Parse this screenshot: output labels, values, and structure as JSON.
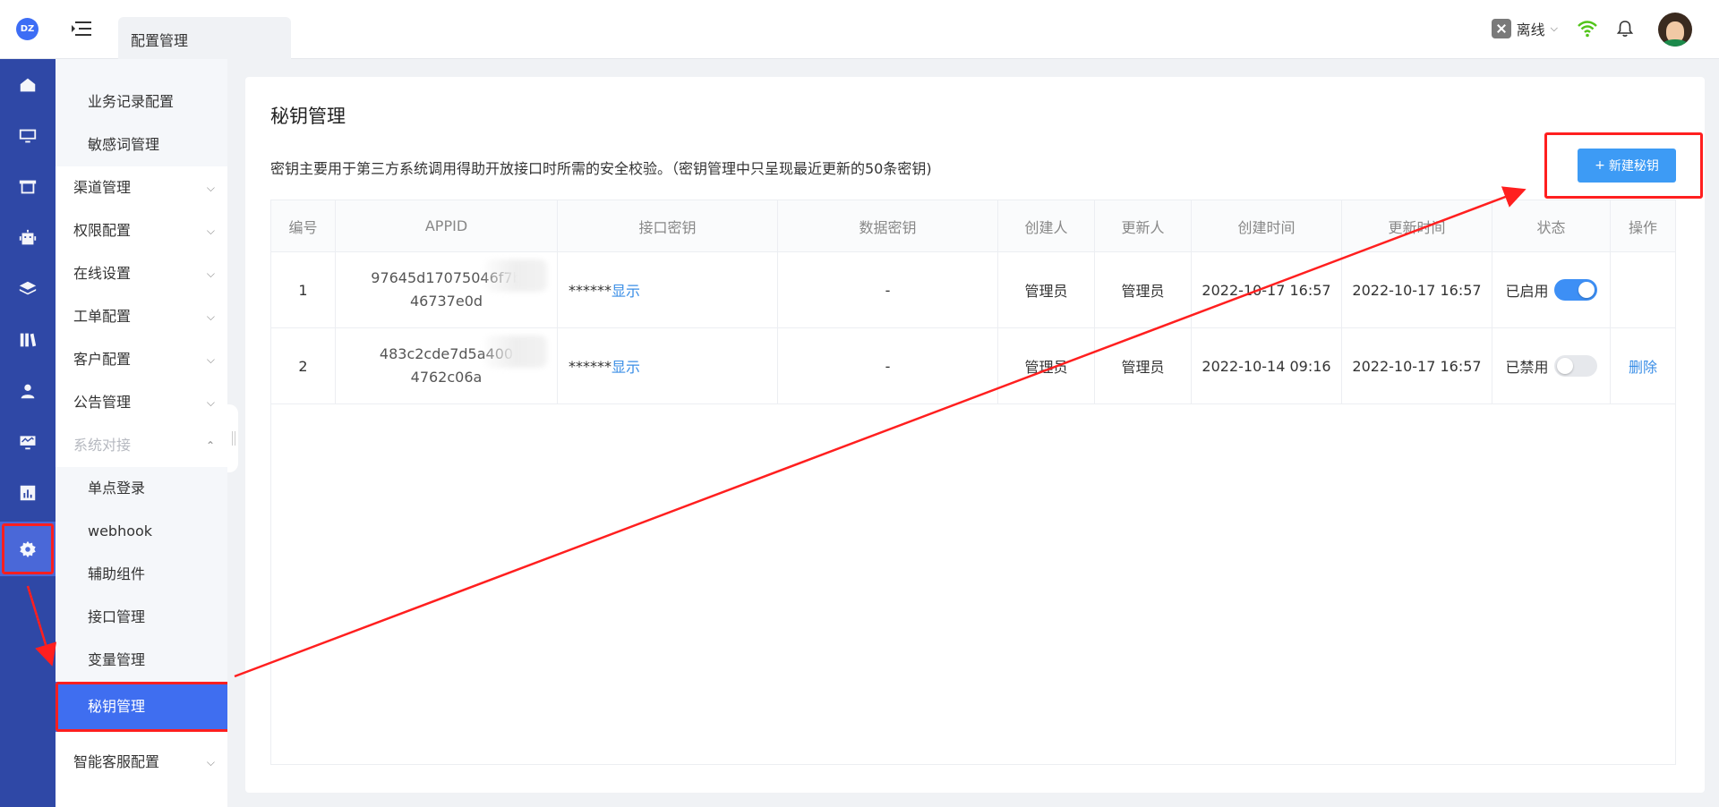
{
  "app": {
    "logo_text": "DZ"
  },
  "rail": {
    "icons": [
      "home-icon",
      "monitor-icon",
      "store-icon",
      "robot-icon",
      "layers-icon",
      "book-icon",
      "user-icon",
      "dashboard-icon",
      "chart-icon",
      "settings-icon"
    ],
    "active": "settings-icon"
  },
  "topbar": {
    "tab_label": "配置管理",
    "status_label": "离线",
    "status_caret": "⌵"
  },
  "sidebar": {
    "items": [
      {
        "label": "业务记录配置",
        "type": "sub"
      },
      {
        "label": "敏感词管理",
        "type": "sub"
      },
      {
        "label": "渠道管理",
        "type": "group",
        "chevron": "⌵"
      },
      {
        "label": "权限配置",
        "type": "group",
        "chevron": "⌵"
      },
      {
        "label": "在线设置",
        "type": "group",
        "chevron": "⌵"
      },
      {
        "label": "工单配置",
        "type": "group",
        "chevron": "⌵"
      },
      {
        "label": "客户配置",
        "type": "group",
        "chevron": "⌵"
      },
      {
        "label": "公告管理",
        "type": "group",
        "chevron": "⌵"
      },
      {
        "label": "系统对接",
        "type": "group-open",
        "chevron": "⌃"
      },
      {
        "label": "单点登录",
        "type": "sub"
      },
      {
        "label": "webhook",
        "type": "sub"
      },
      {
        "label": "辅助组件",
        "type": "sub"
      },
      {
        "label": "接口管理",
        "type": "sub"
      },
      {
        "label": "变量管理",
        "type": "sub"
      },
      {
        "label": "秘钥管理",
        "type": "selected"
      },
      {
        "label": "智能客服配置",
        "type": "group",
        "chevron": "⌵"
      }
    ]
  },
  "main": {
    "title": "秘钥管理",
    "description": "密钥主要用于第三方系统调用得助开放接口时所需的安全校验。（密钥管理中只呈现最近更新的50条密钥)",
    "new_button_label": "新建秘钥",
    "new_button_icon": "+",
    "table": {
      "columns": [
        "编号",
        "APPID",
        "接口密钥",
        "数据密钥",
        "创建人",
        "更新人",
        "创建时间",
        "更新时间",
        "状态",
        "操作"
      ],
      "rows": [
        {
          "id": "1",
          "appid_line1": "97645d17075046f7b",
          "appid_line2": "46737e0d",
          "api_key_mask": "******",
          "api_key_link": "显示",
          "data_key": "-",
          "creator": "管理员",
          "updater": "管理员",
          "created_at": "2022-10-17 16:57",
          "updated_at": "2022-10-17 16:57",
          "status_label": "已启用",
          "status_on": true,
          "action": ""
        },
        {
          "id": "2",
          "appid_line1": "483c2cde7d5a400",
          "appid_line2": "4762c06a",
          "api_key_mask": "******",
          "api_key_link": "显示",
          "data_key": "-",
          "creator": "管理员",
          "updater": "管理员",
          "created_at": "2022-10-14 09:16",
          "updated_at": "2022-10-17 16:57",
          "status_label": "已禁用",
          "status_on": false,
          "action": "删除"
        }
      ]
    }
  },
  "colors": {
    "rail": "#2f48a6",
    "primary": "#3d9bf5",
    "annotation": "#ff1f1f",
    "link": "#3a8ee6"
  }
}
